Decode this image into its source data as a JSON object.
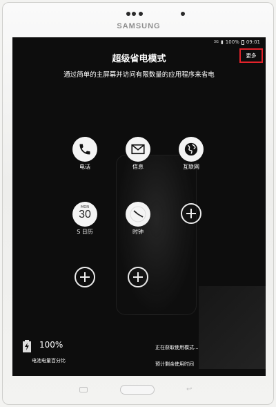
{
  "device": {
    "brand": "SAMSUNG"
  },
  "status_bar": {
    "network": "3G",
    "battery": "100%",
    "time": "09:01"
  },
  "screen": {
    "title": "超级省电模式",
    "subtitle": "通过简单的主屏幕并访问有限数量的应用程序来省电",
    "more_label": "更多"
  },
  "apps": [
    {
      "label": "电话",
      "icon": "phone-icon"
    },
    {
      "label": "信息",
      "icon": "message-icon"
    },
    {
      "label": "互联网",
      "icon": "globe-icon"
    },
    {
      "label": "S 日历",
      "icon": "calendar-icon",
      "cal_month": "MON",
      "cal_day": "30"
    },
    {
      "label": "时钟",
      "icon": "clock-icon"
    }
  ],
  "add_slots": 3,
  "battery": {
    "percent": "100%",
    "label": "电池电量百分比"
  },
  "usage": {
    "status": "正在获取使用模式...",
    "label": "预计剩余使用时间"
  },
  "colors": {
    "highlight": "#e3232b",
    "screen_bg": "#0d0d0d",
    "icon_bg": "#f4f4f4"
  }
}
